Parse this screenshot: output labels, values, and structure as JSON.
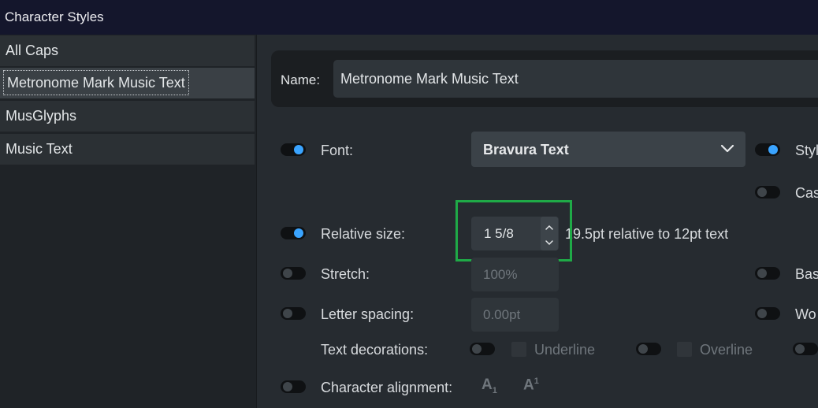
{
  "window": {
    "title": "Character Styles"
  },
  "styles_list": [
    {
      "label": "All Caps",
      "selected": false
    },
    {
      "label": "Metronome Mark Music Text",
      "selected": true
    },
    {
      "label": "MusGlyphs",
      "selected": false
    },
    {
      "label": "Music Text",
      "selected": false
    }
  ],
  "name": {
    "label": "Name:",
    "value": "Metronome Mark Music Text"
  },
  "font": {
    "label": "Font:",
    "value": "Bravura Text",
    "enabled": true
  },
  "style_right": {
    "label": "Styl",
    "enabled": true
  },
  "case_right": {
    "label": "Cas",
    "enabled": false
  },
  "relative_size": {
    "label": "Relative size:",
    "value": "1 5/8",
    "note": "19.5pt relative to 12pt text",
    "enabled": true
  },
  "stretch": {
    "label": "Stretch:",
    "value": "100%",
    "enabled": false
  },
  "baseline_right": {
    "label": "Bas",
    "enabled": false
  },
  "letter_spacing": {
    "label": "Letter spacing:",
    "value": "0.00pt",
    "enabled": false
  },
  "word_right": {
    "label": "Wo",
    "enabled": false
  },
  "text_decorations": {
    "label": "Text decorations:",
    "underline": "Underline",
    "overline": "Overline"
  },
  "character_alignment": {
    "label": "Character alignment:",
    "subscript_letter": "A",
    "subscript_mark": "1",
    "superscript_letter": "A",
    "superscript_mark": "1"
  },
  "colors": {
    "accent": "#3aa4ff",
    "highlight": "#1faa47",
    "titlebar": "#14162c"
  },
  "icons": {
    "dropdown": "chevron-down-icon",
    "step_up": "chevron-up-icon",
    "step_down": "chevron-down-icon"
  }
}
